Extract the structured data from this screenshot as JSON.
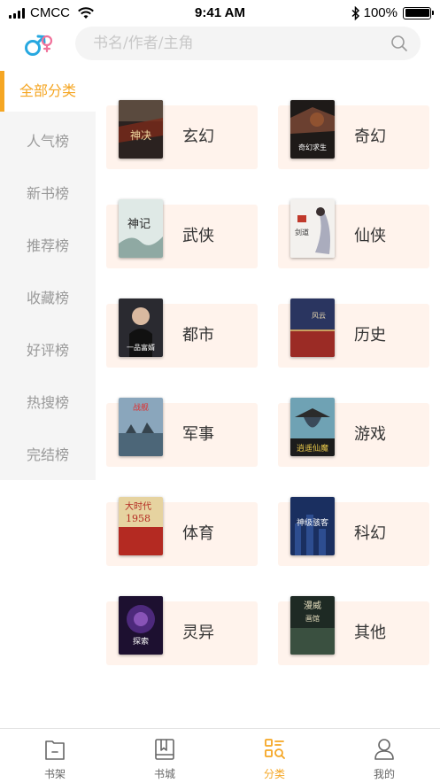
{
  "status_bar": {
    "carrier": "CMCC",
    "time": "9:41 AM",
    "battery": "100%"
  },
  "search": {
    "placeholder": "书名/作者/主角"
  },
  "sidebar": {
    "items": [
      {
        "label": "全部分类",
        "active": true
      },
      {
        "label": "人气榜",
        "active": false
      },
      {
        "label": "新书榜",
        "active": false
      },
      {
        "label": "推荐榜",
        "active": false
      },
      {
        "label": "收藏榜",
        "active": false
      },
      {
        "label": "好评榜",
        "active": false
      },
      {
        "label": "热搜榜",
        "active": false
      },
      {
        "label": "完结榜",
        "active": false
      }
    ]
  },
  "categories": [
    {
      "label": "玄幻",
      "cover_text": "万古帝神决"
    },
    {
      "label": "奇幻",
      "cover_text": "西奇幻求生"
    },
    {
      "label": "武侠",
      "cover_text": "万神记"
    },
    {
      "label": "仙侠",
      "cover_text": "剑道争锋"
    },
    {
      "label": "都市",
      "cover_text": "一品富婿"
    },
    {
      "label": "历史",
      "cover_text": "风云"
    },
    {
      "label": "军事",
      "cover_text": "战舰"
    },
    {
      "label": "游戏",
      "cover_text": "逍遥仙魔"
    },
    {
      "label": "体育",
      "cover_text": "大时代1958"
    },
    {
      "label": "科幻",
      "cover_text": "神级骇客"
    },
    {
      "label": "灵异",
      "cover_text": "灵异探索"
    },
    {
      "label": "其他",
      "cover_text": "漫威有间画馆"
    }
  ],
  "tabbar": {
    "items": [
      {
        "label": "书架",
        "icon": "bookshelf-icon",
        "active": false
      },
      {
        "label": "书城",
        "icon": "bookstore-icon",
        "active": false
      },
      {
        "label": "分类",
        "icon": "category-icon",
        "active": true
      },
      {
        "label": "我的",
        "icon": "profile-icon",
        "active": false
      }
    ]
  },
  "colors": {
    "accent": "#f5a623",
    "card_bg": "#fff3ec",
    "sidebar_bg": "#f5f5f5",
    "gender_icon": "#27a8e0",
    "gender_icon_female": "#f0729b"
  }
}
